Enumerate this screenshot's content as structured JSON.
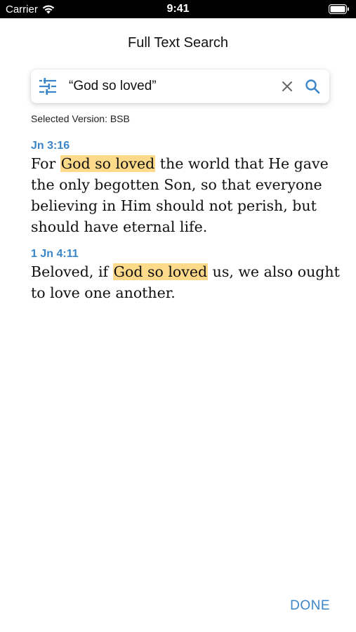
{
  "status_bar": {
    "carrier": "Carrier",
    "time": "9:41",
    "wifi_icon": "wifi-icon",
    "battery_icon": "battery-icon"
  },
  "nav": {
    "title": "Full Text Search"
  },
  "search": {
    "filter_icon": "sliders-icon",
    "query": "“God so loved”",
    "clear_icon": "close-icon",
    "search_icon": "search-icon"
  },
  "version_label": "Selected Version: BSB",
  "results": [
    {
      "ref": "Jn 3:16",
      "before": "For ",
      "match": "God so loved",
      "after": " the world that He gave the only begotten Son, so that everyone believing in Him should not perish, but should have eternal life."
    },
    {
      "ref": "1 Jn 4:11",
      "before": "Beloved, if ",
      "match": "God so loved",
      "after": " us, we also ought to love one another."
    }
  ],
  "done_label": "DONE",
  "colors": {
    "accent": "#3a86c8",
    "highlight": "#fdd98a",
    "status_bar": "#000000"
  }
}
